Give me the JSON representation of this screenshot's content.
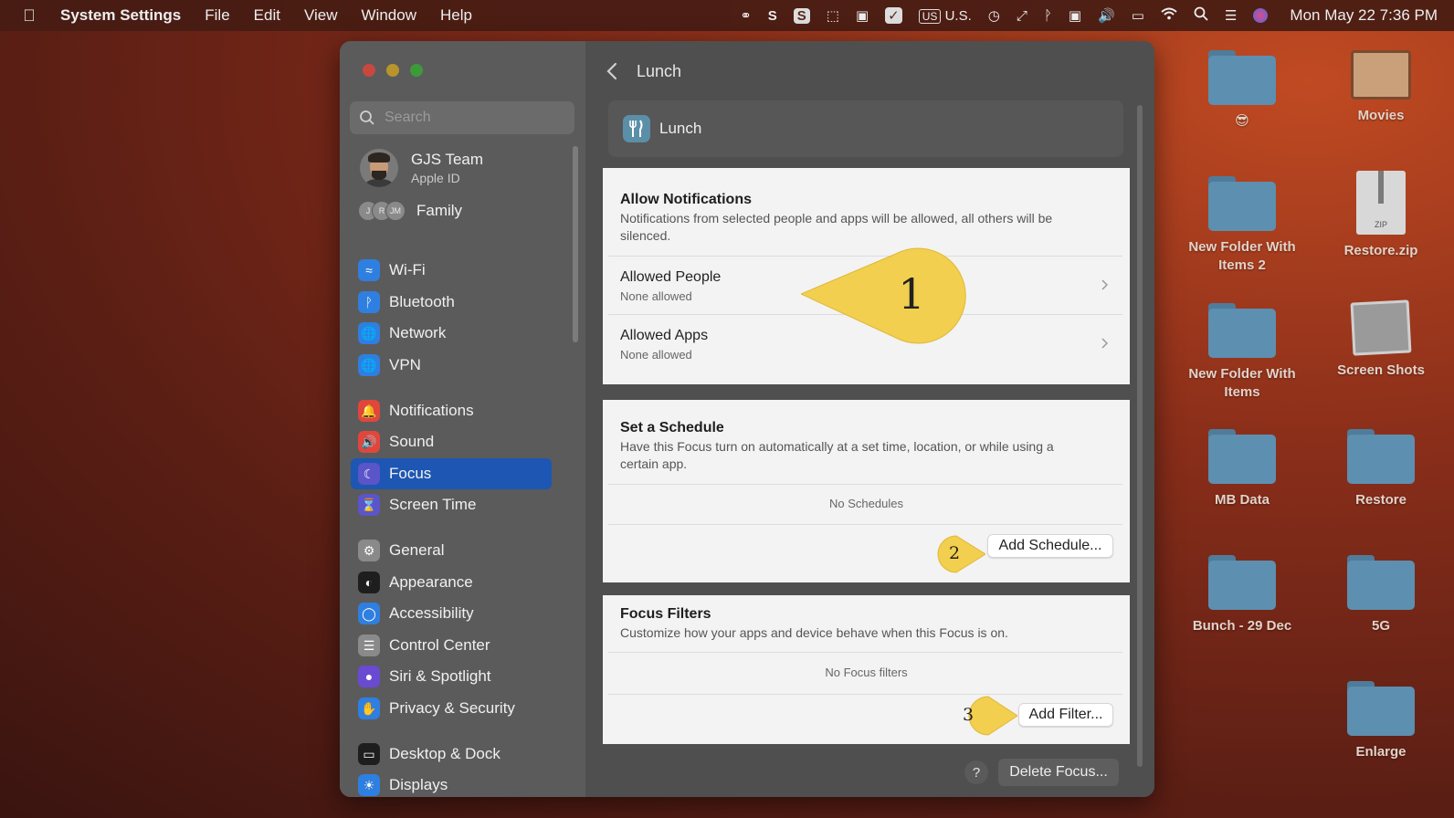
{
  "menubar": {
    "app_name": "System Settings",
    "menus": [
      "File",
      "Edit",
      "View",
      "Window",
      "Help"
    ],
    "input_source": "U.S.",
    "input_badge": "US",
    "clock": "Mon May 22  7:36 PM"
  },
  "sidebar": {
    "search_placeholder": "Search",
    "account_name": "GJS Team",
    "account_sub": "Apple ID",
    "family_label": "Family",
    "family_initials": [
      "J",
      "R",
      "JM"
    ],
    "items": [
      {
        "label": "Wi-Fi",
        "icon": "wifi-icon",
        "color": "#2f7fe0"
      },
      {
        "label": "Bluetooth",
        "icon": "bluetooth-icon",
        "color": "#2f7fe0"
      },
      {
        "label": "Network",
        "icon": "globe-icon",
        "color": "#2f7fe0"
      },
      {
        "label": "VPN",
        "icon": "globe-icon",
        "color": "#2f7fe0"
      },
      {
        "label": "Notifications",
        "icon": "bell-icon",
        "color": "#e0463c"
      },
      {
        "label": "Sound",
        "icon": "speaker-icon",
        "color": "#e0463c"
      },
      {
        "label": "Focus",
        "icon": "moon-icon",
        "color": "#5a55c9"
      },
      {
        "label": "Screen Time",
        "icon": "hourglass-icon",
        "color": "#5a55c9"
      },
      {
        "label": "General",
        "icon": "gear-icon",
        "color": "#8a8a8a"
      },
      {
        "label": "Appearance",
        "icon": "appearance-icon",
        "color": "#1e1e1e"
      },
      {
        "label": "Accessibility",
        "icon": "accessibility-icon",
        "color": "#2f7fe0"
      },
      {
        "label": "Control Center",
        "icon": "control-center-icon",
        "color": "#8a8a8a"
      },
      {
        "label": "Siri & Spotlight",
        "icon": "siri-icon",
        "color": "#6a4ad0"
      },
      {
        "label": "Privacy & Security",
        "icon": "hand-icon",
        "color": "#2f7fe0"
      },
      {
        "label": "Desktop & Dock",
        "icon": "dock-icon",
        "color": "#1e1e1e"
      },
      {
        "label": "Displays",
        "icon": "sun-icon",
        "color": "#2f7fe0"
      }
    ],
    "active": "Focus"
  },
  "main": {
    "title": "Lunch",
    "focus_name": "Lunch",
    "allow": {
      "title": "Allow Notifications",
      "desc": "Notifications from selected people and apps will be allowed, all others will be silenced.",
      "rows": [
        {
          "title": "Allowed People",
          "sub": "None allowed"
        },
        {
          "title": "Allowed Apps",
          "sub": "None allowed"
        }
      ]
    },
    "schedule": {
      "title": "Set a Schedule",
      "desc": "Have this Focus turn on automatically at a set time, location, or while using a certain app.",
      "empty": "No Schedules",
      "button": "Add Schedule..."
    },
    "filters": {
      "title": "Focus Filters",
      "desc": "Customize how your apps and device behave when this Focus is on.",
      "empty": "No Focus filters",
      "button": "Add Filter..."
    },
    "help": "?",
    "delete_button": "Delete Focus...",
    "callouts": [
      "1",
      "2",
      "3"
    ]
  },
  "desktop": {
    "items": [
      {
        "label": "😎",
        "kind": "folder"
      },
      {
        "label": "Movies",
        "kind": "movies"
      },
      {
        "label": "New Folder With Items 2",
        "kind": "folder"
      },
      {
        "label": "Restore.zip",
        "kind": "zip",
        "badge": "ZIP"
      },
      {
        "label": "New Folder With Items",
        "kind": "folder"
      },
      {
        "label": "Screen Shots",
        "kind": "shots"
      },
      {
        "label": "MB Data",
        "kind": "folder"
      },
      {
        "label": "Restore",
        "kind": "folder"
      },
      {
        "label": "Bunch - 29 Dec",
        "kind": "folder"
      },
      {
        "label": "5G",
        "kind": "folder"
      },
      {
        "label": "Enlarge",
        "kind": "folder"
      }
    ]
  }
}
